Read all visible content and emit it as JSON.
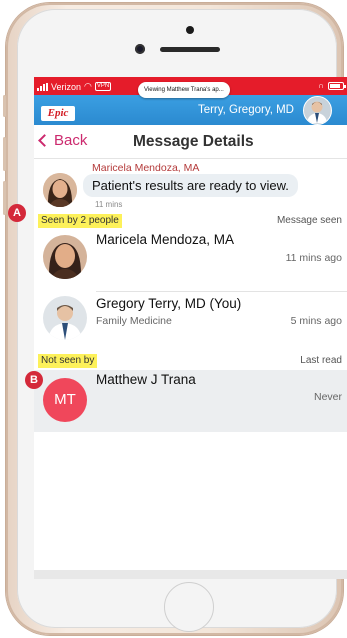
{
  "status_bar": {
    "carrier": "Verizon",
    "vpn": "VPN",
    "banner_text": "Viewing Matthew Trana's ap..."
  },
  "app_bar": {
    "logo": "Epic",
    "user_name": "Terry, Gregory, MD"
  },
  "nav": {
    "back_label": "Back",
    "title": "Message Details"
  },
  "message": {
    "sender": "Maricela Mendoza, MA",
    "text": "Patient's results are ready to view.",
    "time": "11 mins"
  },
  "seen_section": {
    "label": "Seen by 2 people",
    "status": "Message seen"
  },
  "seen_people": [
    {
      "name": "Maricela Mendoza, MA",
      "role": "",
      "time": "11 mins ago"
    },
    {
      "name": "Gregory Terry, MD (You)",
      "role": "Family Medicine",
      "time": "5 mins ago"
    }
  ],
  "not_seen_section": {
    "label": "Not seen by",
    "status": "Last read"
  },
  "not_seen_people": [
    {
      "initials": "MT",
      "name": "Matthew J Trana",
      "time": "Never"
    }
  ],
  "annotations": {
    "a": "A",
    "b": "B"
  },
  "colors": {
    "accent": "#cc2a6e",
    "app_bar": "#2b8ad0",
    "status_bar": "#e51c2a",
    "highlight": "#fdf15a",
    "badge": "#d4293a",
    "mt_avatar": "#f0475b"
  }
}
